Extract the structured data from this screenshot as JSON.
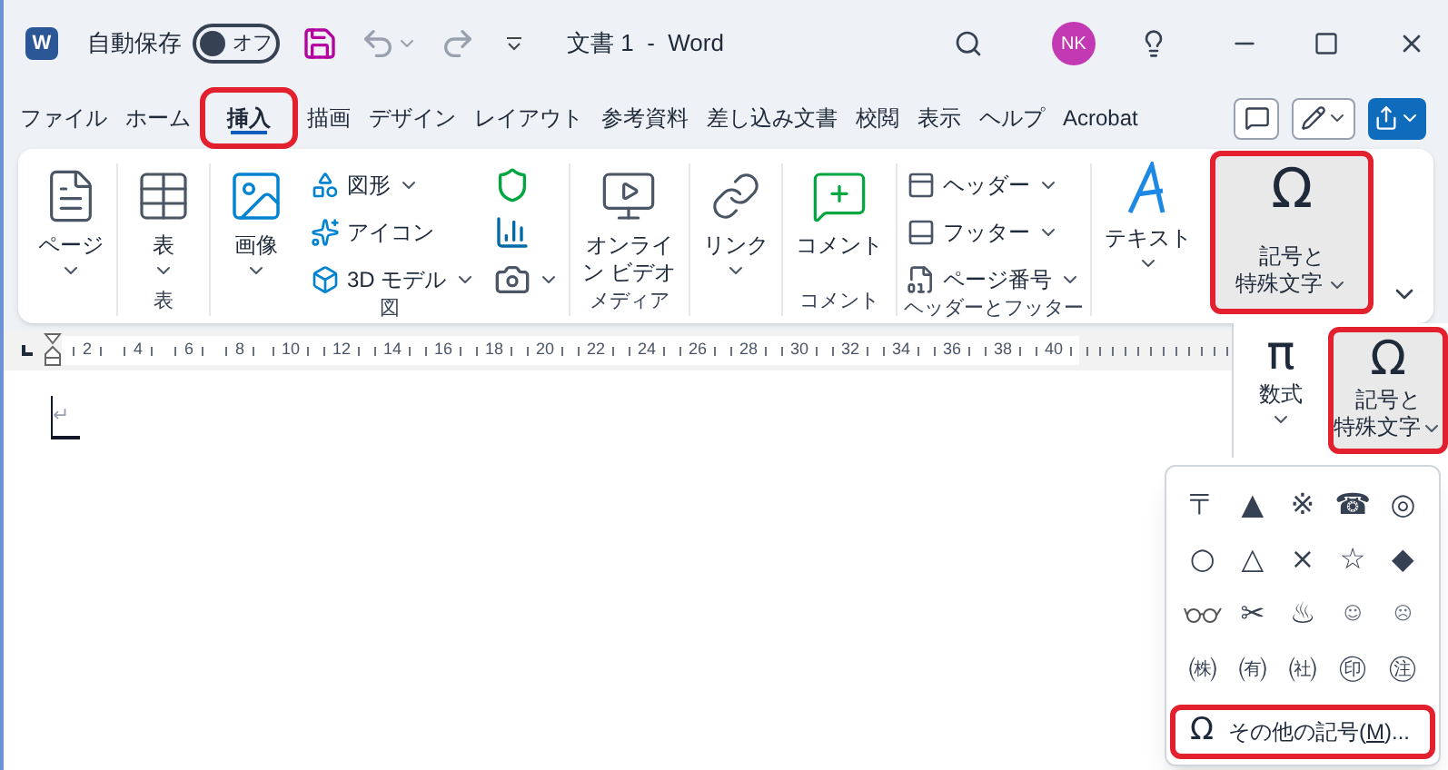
{
  "title_bar": {
    "logo": "W",
    "autosave_label": "自動保存",
    "autosave_toggle": {
      "label": "オフ",
      "on": false
    },
    "document_title": "文書 1  -  Word",
    "avatar": "NK"
  },
  "tabs": [
    {
      "label": "ファイル",
      "selected": false
    },
    {
      "label": "ホーム",
      "selected": false
    },
    {
      "label": "挿入",
      "selected": true
    },
    {
      "label": "描画",
      "selected": false
    },
    {
      "label": "デザイン",
      "selected": false
    },
    {
      "label": "レイアウト",
      "selected": false
    },
    {
      "label": "参考資料",
      "selected": false
    },
    {
      "label": "差し込み文書",
      "selected": false
    },
    {
      "label": "校閲",
      "selected": false
    },
    {
      "label": "表示",
      "selected": false
    },
    {
      "label": "ヘルプ",
      "selected": false
    },
    {
      "label": "Acrobat",
      "selected": false
    }
  ],
  "ribbon": {
    "groups": [
      {
        "items": [
          {
            "kind": "large",
            "lines": [
              "ページ"
            ],
            "dropdown": true,
            "selected": false
          }
        ]
      },
      {
        "label": "表",
        "items": [
          {
            "kind": "large",
            "lines": [
              "表"
            ],
            "dropdown": true,
            "selected": false
          }
        ]
      },
      {
        "label": "図",
        "items": [
          {
            "kind": "large",
            "lines": [
              "画像"
            ],
            "dropdown": true,
            "selected": false
          },
          {
            "kind": "stack",
            "items": [
              {
                "kind": "small",
                "label": "図形",
                "dropdown": true
              },
              {
                "kind": "small",
                "label": "アイコン",
                "dropdown": false
              },
              {
                "kind": "small",
                "label": "3D モデル",
                "dropdown": true
              }
            ]
          },
          {
            "kind": "stack",
            "items": [
              {
                "kind": "icon",
                "dropdown": false
              },
              {
                "kind": "icon",
                "dropdown": false
              },
              {
                "kind": "icon",
                "dropdown": true
              }
            ]
          }
        ]
      },
      {
        "label": "メディア",
        "items": [
          {
            "kind": "large",
            "lines": [
              "オンライ",
              "ン ビデオ"
            ],
            "dropdown": false,
            "selected": false
          }
        ]
      },
      {
        "items": [
          {
            "kind": "large",
            "lines": [
              "リンク"
            ],
            "dropdown": true,
            "selected": false
          }
        ]
      },
      {
        "label": "コメント",
        "items": [
          {
            "kind": "large",
            "lines": [
              "コメント"
            ],
            "dropdown": false,
            "selected": false
          }
        ]
      },
      {
        "label": "ヘッダーとフッター",
        "items": [
          {
            "kind": "stack",
            "items": [
              {
                "kind": "small",
                "label": "ヘッダー",
                "dropdown": true
              },
              {
                "kind": "small",
                "label": "フッター",
                "dropdown": true
              },
              {
                "kind": "small",
                "label": "ページ番号",
                "dropdown": true
              }
            ]
          }
        ]
      },
      {
        "items": [
          {
            "kind": "large",
            "lines": [
              "テキスト"
            ],
            "dropdown": true,
            "selected": false
          }
        ]
      },
      {
        "items": [
          {
            "kind": "large",
            "glyph": "Ω",
            "lines": [
              "記号と",
              "特殊文字"
            ],
            "dropdown": true,
            "selected": true
          }
        ]
      }
    ]
  },
  "ruler": {
    "numbers": [
      "2",
      "4",
      "6",
      "8",
      "10",
      "12",
      "14",
      "16",
      "18",
      "20",
      "22",
      "24",
      "26",
      "28",
      "30",
      "32",
      "34",
      "36",
      "38",
      "40"
    ]
  },
  "document": {
    "paragraph_mark": "↵"
  },
  "symbol_panel": {
    "buttons": [
      {
        "glyph": "π",
        "lines": [
          "数式"
        ],
        "selected": false
      },
      {
        "glyph": "Ω",
        "lines": [
          "記号と",
          "特殊文字"
        ],
        "selected": true
      }
    ]
  },
  "symbol_menu": {
    "symbols": [
      {
        "kind": "char",
        "char": "〒"
      },
      {
        "kind": "char",
        "char": "▲"
      },
      {
        "kind": "char",
        "char": "※"
      },
      {
        "kind": "char",
        "char": "☎"
      },
      {
        "kind": "char",
        "char": "◎"
      },
      {
        "kind": "char",
        "char": "○"
      },
      {
        "kind": "char",
        "char": "△"
      },
      {
        "kind": "char",
        "char": "×"
      },
      {
        "kind": "char",
        "char": "☆"
      },
      {
        "kind": "char",
        "char": "◆"
      },
      {
        "kind": "glasses"
      },
      {
        "kind": "char",
        "char": "✂"
      },
      {
        "kind": "char",
        "char": "♨"
      },
      {
        "kind": "small_char",
        "char": "☺"
      },
      {
        "kind": "small_char",
        "char": "☹"
      },
      {
        "kind": "char",
        "char": "㈱"
      },
      {
        "kind": "char",
        "char": "㈲"
      },
      {
        "kind": "char",
        "char": "㈳"
      },
      {
        "kind": "char",
        "char": "㊞"
      },
      {
        "kind": "char",
        "char": "㊟"
      }
    ],
    "more": {
      "glyph": "Ω",
      "before": "その他の記号(",
      "key": "M",
      "after": ")...",
      "selected": true
    }
  }
}
